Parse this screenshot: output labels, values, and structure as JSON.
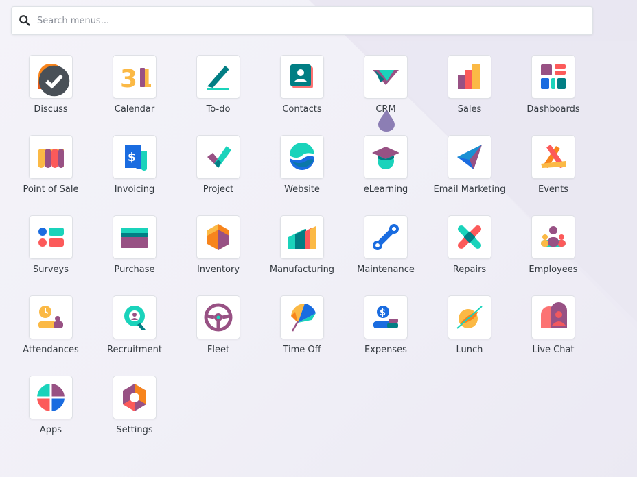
{
  "search": {
    "placeholder": "Search menus..."
  },
  "apps": [
    {
      "key": "discuss",
      "label": "Discuss"
    },
    {
      "key": "calendar",
      "label": "Calendar",
      "glyph": "31"
    },
    {
      "key": "todo",
      "label": "To-do"
    },
    {
      "key": "contacts",
      "label": "Contacts"
    },
    {
      "key": "crm",
      "label": "CRM"
    },
    {
      "key": "sales",
      "label": "Sales"
    },
    {
      "key": "dashboards",
      "label": "Dashboards"
    },
    {
      "key": "point-of-sale",
      "label": "Point of Sale"
    },
    {
      "key": "invoicing",
      "label": "Invoicing",
      "glyph": "$"
    },
    {
      "key": "project",
      "label": "Project"
    },
    {
      "key": "website",
      "label": "Website"
    },
    {
      "key": "elearning",
      "label": "eLearning"
    },
    {
      "key": "email-marketing",
      "label": "Email Marketing"
    },
    {
      "key": "events",
      "label": "Events"
    },
    {
      "key": "surveys",
      "label": "Surveys"
    },
    {
      "key": "purchase",
      "label": "Purchase"
    },
    {
      "key": "inventory",
      "label": "Inventory"
    },
    {
      "key": "manufacturing",
      "label": "Manufacturing"
    },
    {
      "key": "maintenance",
      "label": "Maintenance"
    },
    {
      "key": "repairs",
      "label": "Repairs"
    },
    {
      "key": "employees",
      "label": "Employees"
    },
    {
      "key": "attendances",
      "label": "Attendances"
    },
    {
      "key": "recruitment",
      "label": "Recruitment"
    },
    {
      "key": "fleet",
      "label": "Fleet"
    },
    {
      "key": "time-off",
      "label": "Time Off"
    },
    {
      "key": "expenses",
      "label": "Expenses",
      "glyph": "$"
    },
    {
      "key": "lunch",
      "label": "Lunch"
    },
    {
      "key": "live-chat",
      "label": "Live Chat"
    },
    {
      "key": "apps",
      "label": "Apps"
    },
    {
      "key": "settings",
      "label": "Settings"
    }
  ],
  "colors": {
    "orange": "#F7841C",
    "teal": "#1AD3BB",
    "purple": "#985184",
    "dark-teal": "#017E84",
    "blue": "#1A6CE0",
    "red": "#FC5A5A",
    "yellow": "#FBB945"
  }
}
